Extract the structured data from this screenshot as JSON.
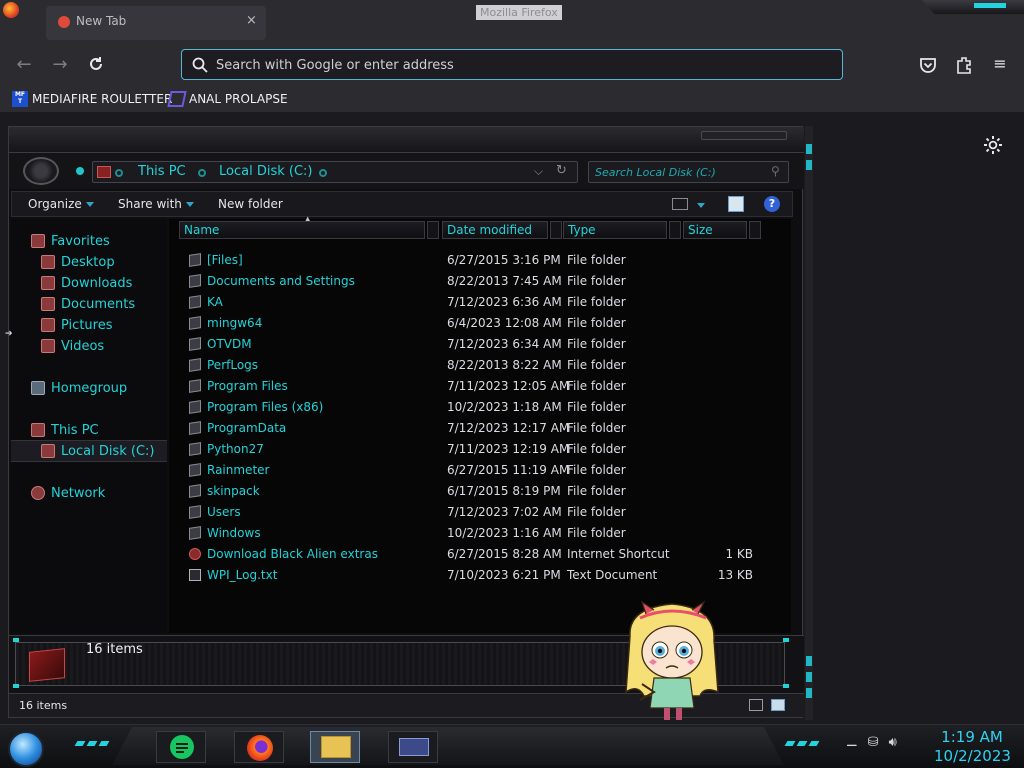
{
  "browser": {
    "window_title": "Mozilla Firefox",
    "tab_title": "New Tab",
    "search_placeholder": "Search with Google or enter address",
    "bookmarks": [
      {
        "label": "MEDIAFIRE ROULETTER",
        "icon": "MF"
      },
      {
        "label": "ANAL PROLAPSE"
      }
    ]
  },
  "explorer": {
    "breadcrumb": [
      "This PC",
      "Local Disk (C:)"
    ],
    "search_placeholder": "Search Local Disk (C:)",
    "toolbar": {
      "organize": "Organize",
      "share_with": "Share with",
      "new_folder": "New folder",
      "help": "?"
    },
    "nav": {
      "favorites": "Favorites",
      "desktop": "Desktop",
      "downloads": "Downloads",
      "documents": "Documents",
      "pictures": "Pictures",
      "videos": "Videos",
      "homegroup": "Homegroup",
      "this_pc": "This PC",
      "local_disk": "Local Disk (C:)",
      "network": "Network"
    },
    "columns": [
      "Name",
      "Date modified",
      "Type",
      "Size"
    ],
    "files": [
      {
        "name": "[Files]",
        "date": "6/27/2015 3:16 PM",
        "type": "File folder",
        "size": ""
      },
      {
        "name": "Documents and Settings",
        "date": "8/22/2013 7:45 AM",
        "type": "File folder",
        "size": ""
      },
      {
        "name": "KA",
        "date": "7/12/2023 6:36 AM",
        "type": "File folder",
        "size": ""
      },
      {
        "name": "mingw64",
        "date": "6/4/2023 12:08 AM",
        "type": "File folder",
        "size": ""
      },
      {
        "name": "OTVDM",
        "date": "7/12/2023 6:34 AM",
        "type": "File folder",
        "size": ""
      },
      {
        "name": "PerfLogs",
        "date": "8/22/2013 8:22 AM",
        "type": "File folder",
        "size": ""
      },
      {
        "name": "Program Files",
        "date": "7/11/2023 12:05 AM",
        "type": "File folder",
        "size": ""
      },
      {
        "name": "Program Files (x86)",
        "date": "10/2/2023 1:18 AM",
        "type": "File folder",
        "size": ""
      },
      {
        "name": "ProgramData",
        "date": "7/12/2023 12:17 AM",
        "type": "File folder",
        "size": ""
      },
      {
        "name": "Python27",
        "date": "7/11/2023 12:19 AM",
        "type": "File folder",
        "size": ""
      },
      {
        "name": "Rainmeter",
        "date": "6/27/2015 11:19 AM",
        "type": "File folder",
        "size": ""
      },
      {
        "name": "skinpack",
        "date": "6/17/2015 8:19 PM",
        "type": "File folder",
        "size": ""
      },
      {
        "name": "Users",
        "date": "7/12/2023 7:02 AM",
        "type": "File folder",
        "size": ""
      },
      {
        "name": "Windows",
        "date": "10/2/2023 1:16 AM",
        "type": "File folder",
        "size": ""
      },
      {
        "name": "Download Black Alien extras",
        "date": "6/27/2015 8:28 AM",
        "type": "Internet Shortcut",
        "size": "1 KB"
      },
      {
        "name": "WPI_Log.txt",
        "date": "7/10/2023 6:21 PM",
        "type": "Text Document",
        "size": "13 KB"
      }
    ],
    "details_count": "16 items",
    "status_text": "16 items"
  },
  "taskbar": {
    "clock_time": "1:19 AM",
    "clock_date": "10/2/2023"
  },
  "colors": {
    "accent_cyan": "#22d3d8",
    "url_focus": "#5ab4d8",
    "clock": "#2fd1f3"
  }
}
